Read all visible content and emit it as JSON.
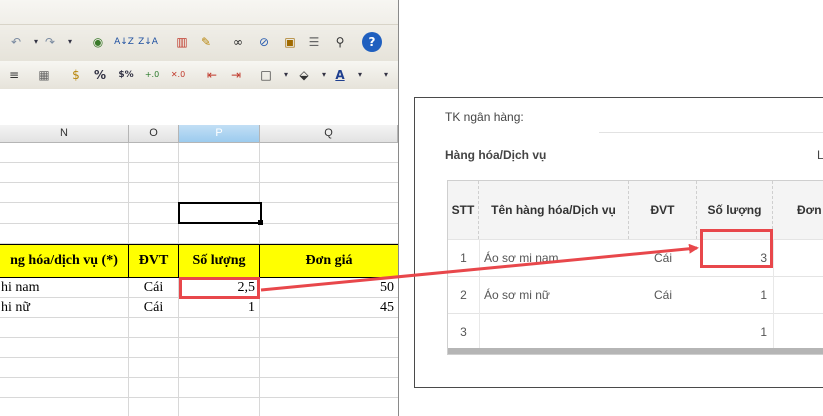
{
  "spreadsheet": {
    "columns": [
      "N",
      "O",
      "P",
      "Q"
    ],
    "header_row": {
      "name": "ng hóa/dịch vụ (*)",
      "unit": "ĐVT",
      "quantity": "Số lượng",
      "price": "Đơn giá"
    },
    "rows": [
      {
        "name": "hi nam",
        "unit": "Cái",
        "quantity": "2,5",
        "price": "50"
      },
      {
        "name": "hi nữ",
        "unit": "Cái",
        "quantity": "1",
        "price": "45"
      }
    ],
    "colors": {
      "header_fill": "#ffff00",
      "highlight": "#e8474b"
    }
  },
  "form": {
    "bank_label": "TK ngân hàng:",
    "section_title": "Hàng hóa/Dịch vụ",
    "section_right_char": "L",
    "table": {
      "headers": {
        "stt": "STT",
        "name": "Tên hàng hóa/Dịch vụ",
        "unit": "ĐVT",
        "quantity": "Số lượng",
        "price": "Đơn"
      },
      "rows": [
        {
          "stt": "1",
          "name": "Áo sơ mi nam",
          "unit": "Cái",
          "quantity": "3"
        },
        {
          "stt": "2",
          "name": "Áo sơ mi nữ",
          "unit": "Cái",
          "quantity": "1"
        },
        {
          "stt": "3",
          "name": "",
          "unit": "",
          "quantity": "1"
        }
      ]
    }
  }
}
